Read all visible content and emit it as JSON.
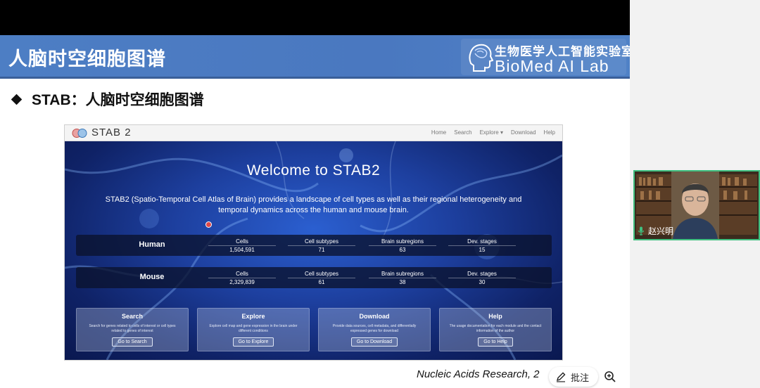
{
  "slide": {
    "banner_title": "人脑时空细胞图谱",
    "lab_name_cn": "生物医学人工智能实验室",
    "lab_name_en": "BioMed AI Lab",
    "subtitle": "STAB：人脑时空细胞图谱",
    "citation": "Nucleic Acids Research, 2"
  },
  "website": {
    "brand": "STAB 2",
    "nav": [
      "Home",
      "Search",
      "Explore ▾",
      "Download",
      "Help"
    ],
    "title": "Welcome to STAB2",
    "description": "STAB2 (Spatio-Temporal Cell Atlas of Brain) provides a landscape of cell types as well as their regional heterogeneity and temporal dynamics across the human and mouse brain.",
    "stats": {
      "human": {
        "label": "Human",
        "cells_label": "Cells",
        "cells": "1,504,591",
        "subtypes_label": "Cell subtypes",
        "subtypes": "71",
        "subregions_label": "Brain subregions",
        "subregions": "63",
        "stages_label": "Dev. stages",
        "stages": "15"
      },
      "mouse": {
        "label": "Mouse",
        "cells_label": "Cells",
        "cells": "2,329,839",
        "subtypes_label": "Cell subtypes",
        "subtypes": "61",
        "subregions_label": "Brain subregions",
        "subregions": "38",
        "stages_label": "Dev. stages",
        "stages": "30"
      }
    },
    "cards": [
      {
        "title": "Search",
        "desc": "Search for genes related to cells of interest or cell types related to genes of interest",
        "button": "Go to Search"
      },
      {
        "title": "Explore",
        "desc": "Explore cell map and gene expression in the brain under different conditions",
        "button": "Go to Explore"
      },
      {
        "title": "Download",
        "desc": "Provide data sources, cell metadata, and differentially expressed genes for download",
        "button": "Go to Download"
      },
      {
        "title": "Help",
        "desc": "The usage documentation for each module and the contact information of the author",
        "button": "Go to Help"
      }
    ]
  },
  "toolbar": {
    "annotate_label": "批注"
  },
  "camera": {
    "participant_name": "赵兴明"
  },
  "colors": {
    "banner_blue": "#4a78c0",
    "camera_border": "#3fbf7f"
  }
}
